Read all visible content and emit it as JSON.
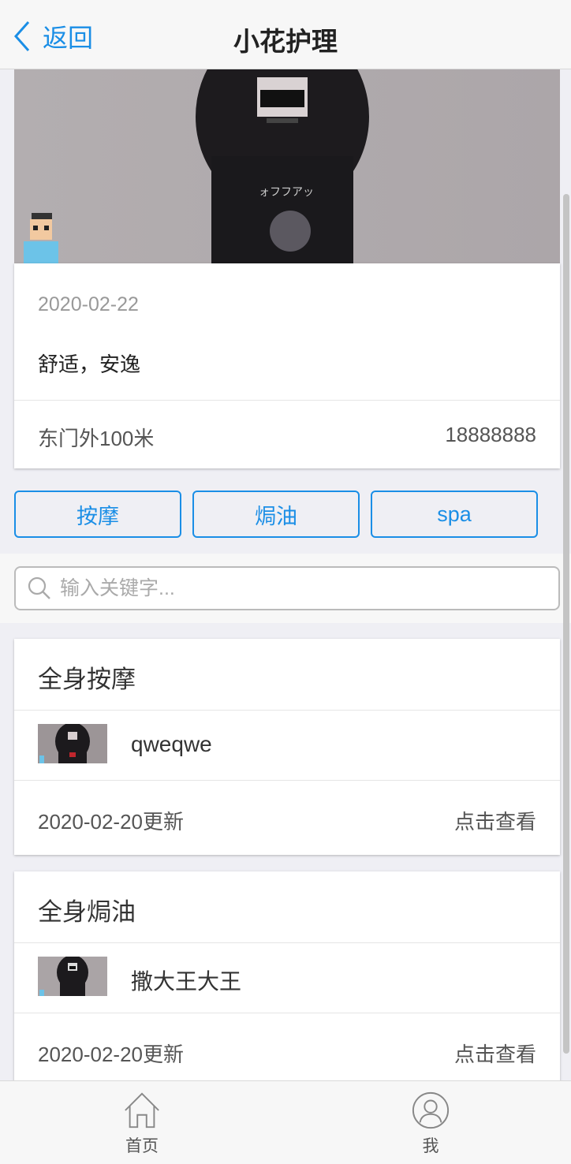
{
  "header": {
    "back_label": "返回",
    "title": "小花护理"
  },
  "shop": {
    "date": "2020-02-22",
    "description": "舒适，安逸",
    "address": "东门外100米",
    "phone": "18888888"
  },
  "tags": [
    "按摩",
    "焗油",
    "spa"
  ],
  "search": {
    "placeholder": "输入关键字...",
    "value": ""
  },
  "services": [
    {
      "title": "全身按摩",
      "name": "qweqwe",
      "updated": "2020-02-20更新",
      "view_label": "点击查看"
    },
    {
      "title": "全身焗油",
      "name": "撒大王大王",
      "updated": "2020-02-20更新",
      "view_label": "点击查看"
    }
  ],
  "tabbar": {
    "home_label": "首页",
    "me_label": "我"
  },
  "colors": {
    "accent": "#1a8ee6",
    "background": "#efeff4",
    "header_bg": "#f7f7f7"
  },
  "icons": [
    "chevron-left-icon",
    "search-icon",
    "home-icon",
    "user-icon"
  ]
}
